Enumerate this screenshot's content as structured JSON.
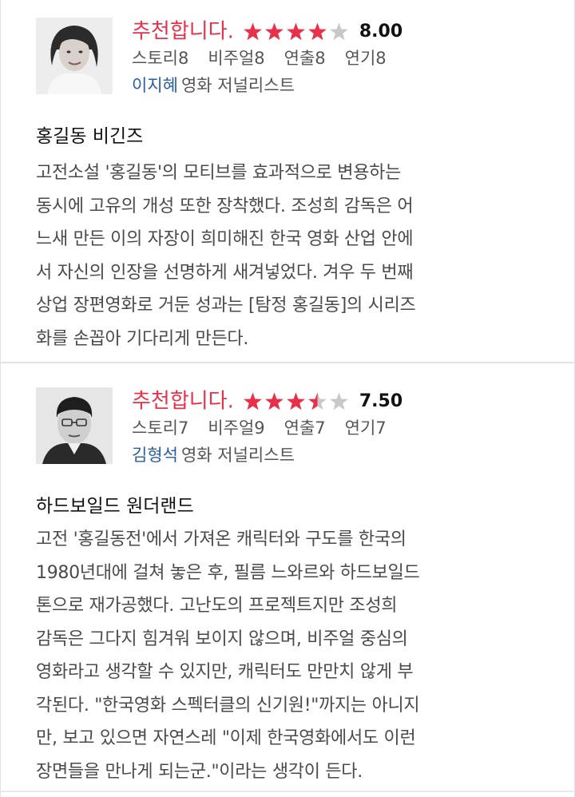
{
  "reviews": [
    {
      "verdict": "추천합니다.",
      "rating": 4,
      "score": "8.00",
      "sub_scores": [
        "스토리8",
        "비주얼8",
        "연출8",
        "연기8"
      ],
      "reviewer_name": "이지혜",
      "reviewer_role": "영화 저널리스트",
      "movie_title": "홍길동 비긴즈",
      "body_lines": [
        "고전소설 '홍길동'의 모티브를 효과적으로 변용하는",
        "동시에 고유의 개성 또한 장착했다. 조성희 감독은 어",
        "느새 만든 이의 자장이 희미해진 한국 영화 산업 안에",
        "서 자신의 인장을 선명하게 새겨넣었다. 겨우 두 번째",
        "상업 장편영화로 거둔 성과는 [탐정 홍길동]의 시리즈",
        "화를 손꼽아 기다리게 만든다."
      ]
    },
    {
      "verdict": "추천합니다.",
      "rating": 3.5,
      "score": "7.50",
      "sub_scores": [
        "스토리7",
        "비주얼9",
        "연출7",
        "연기7"
      ],
      "reviewer_name": "김형석",
      "reviewer_role": "영화 저널리스트",
      "movie_title": "하드보일드 원더랜드",
      "body_lines": [
        "고전 '홍길동전'에서 가져온 캐릭터와 구도를 한국의",
        "1980년대에 걸쳐 놓은 후, 필름 느와르와 하드보일드",
        "톤으로 재가공했다. 고난도의 프로젝트지만 조성희",
        "감독은 그다지 힘겨워 보이지 않으며, 비주얼 중심의",
        "영화라고 생각할 수 있지만, 캐릭터도 만만치 않게 부",
        "각된다. \"한국영화 스펙터클의 신기원!\"까지는 아니지",
        "만, 보고 있으면 자연스레 \"이제 한국영화에서도 이런",
        "장면들을 만나게 되는군.\"이라는 생각이 든다."
      ]
    }
  ],
  "colors": {
    "verdict": "#e8304a",
    "star_filled": "#e8304a",
    "star_empty": "#c8c8c8",
    "reviewer_name": "#2a5da8"
  }
}
